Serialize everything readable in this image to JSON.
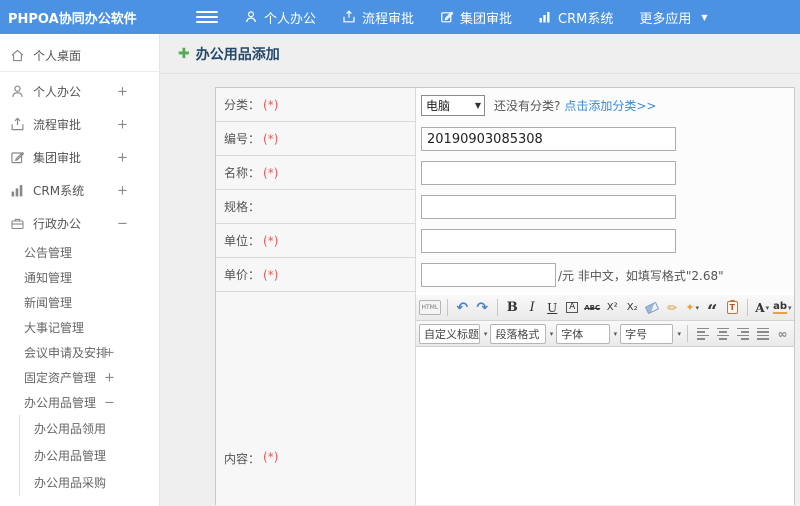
{
  "topbar": {
    "brand": "PHPOA协同办公软件",
    "nav": [
      {
        "label": "个人办公"
      },
      {
        "label": "流程审批"
      },
      {
        "label": "集团审批"
      },
      {
        "label": "CRM系统"
      },
      {
        "label": "更多应用"
      }
    ],
    "caret_icon": "▼"
  },
  "sidebar": {
    "items": [
      {
        "label": "个人桌面",
        "expander": ""
      },
      {
        "label": "个人办公",
        "expander": "+"
      },
      {
        "label": "流程审批",
        "expander": "+"
      },
      {
        "label": "集团审批",
        "expander": "+"
      },
      {
        "label": "CRM系统",
        "expander": "+"
      },
      {
        "label": "行政办公",
        "expander": "−"
      }
    ],
    "admin_children": [
      {
        "label": "公告管理",
        "expander": ""
      },
      {
        "label": "通知管理",
        "expander": ""
      },
      {
        "label": "新闻管理",
        "expander": ""
      },
      {
        "label": "大事记管理",
        "expander": ""
      },
      {
        "label": "会议申请及安排",
        "expander": "+"
      },
      {
        "label": "固定资产管理",
        "expander": "+"
      },
      {
        "label": "办公用品管理",
        "expander": "−"
      }
    ],
    "supplies_children": [
      {
        "label": "办公用品领用"
      },
      {
        "label": "办公用品管理"
      },
      {
        "label": "办公用品采购"
      }
    ]
  },
  "page": {
    "title": "办公用品添加"
  },
  "form": {
    "category": {
      "label": "分类：",
      "required": "(*)",
      "select_value": "电脑",
      "select_caret": "▼",
      "hint": "还没有分类?",
      "hint_link": "点击添加分类>>"
    },
    "code": {
      "label": "编号：",
      "required": "(*)",
      "value": "20190903085308"
    },
    "name": {
      "label": "名称：",
      "required": "(*)",
      "value": ""
    },
    "spec": {
      "label": "规格：",
      "required": "",
      "value": ""
    },
    "unit": {
      "label": "单位：",
      "required": "(*)",
      "value": ""
    },
    "price": {
      "label": "单价：",
      "required": "(*)",
      "value": "",
      "suffix": "/元 非中文，如填写格式\"2.68\""
    },
    "content": {
      "label": "内容：",
      "required": "(*)"
    }
  },
  "editor": {
    "html_button": "HTML",
    "undo_icon": "↶",
    "redo_icon": "↷",
    "bold": "B",
    "italic": "I",
    "underline": "U",
    "char_border": "A",
    "strikethrough": "ABC",
    "superscript": "X²",
    "subscript": "X₂",
    "brush_icon": "✏",
    "wand_icon": "✦",
    "dropdown_caret": "▾",
    "blockquote_icon": "“",
    "paste_letter": "T",
    "font_color": "A",
    "highlight": "ab",
    "heading_select": "自定义标题",
    "paragraph_select": "段落格式",
    "font_select": "字体",
    "size_select": "字号",
    "link_icon": "∞"
  },
  "colors": {
    "topbar_blue": "#4b92e3",
    "link_blue": "#3b8ad6",
    "required_red": "#e15a5a",
    "title_navy": "#25496d",
    "accent_green": "#57a957"
  }
}
